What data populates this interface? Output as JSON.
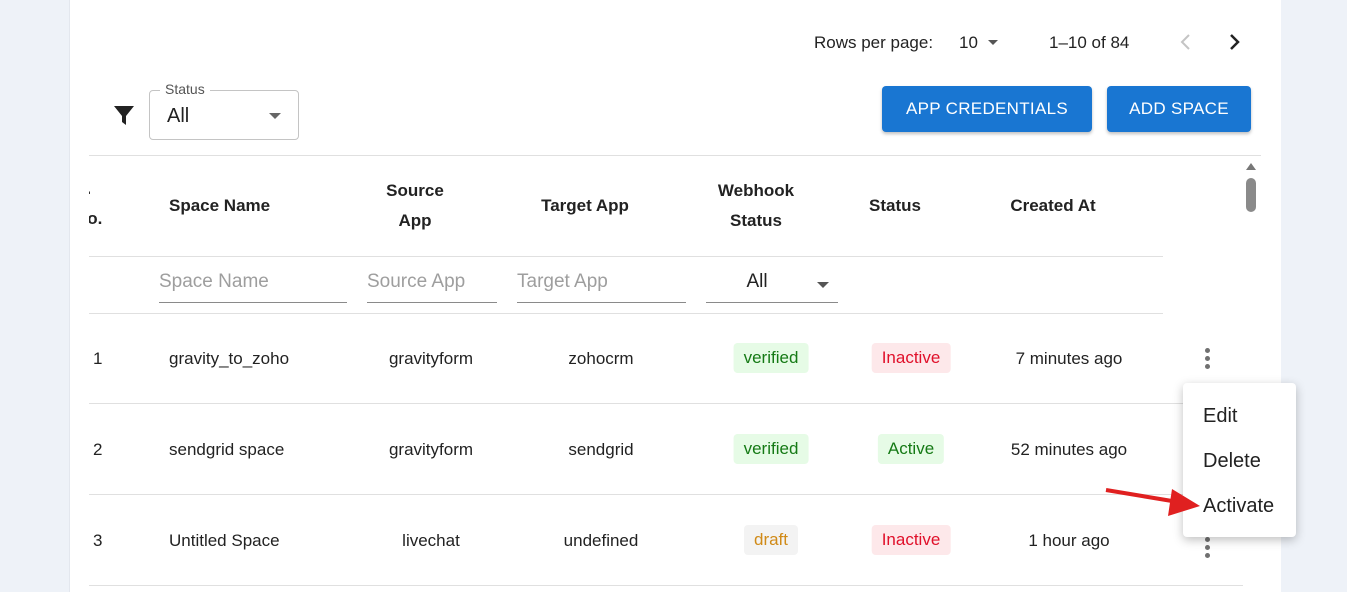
{
  "pagination": {
    "rows_per_page_label": "Rows per page:",
    "rows_per_page": "10",
    "range": "1–10 of 84"
  },
  "filter": {
    "status_label": "Status",
    "status_value": "All"
  },
  "buttons": {
    "app_credentials": "APP CREDENTIALS",
    "add_space": "ADD SPACE"
  },
  "table": {
    "headers": {
      "sno_1": "S.",
      "sno_2": "No.",
      "space_name": "Space Name",
      "source_1": "Source",
      "source_2": "App",
      "target": "Target App",
      "webhook_1": "Webhook",
      "webhook_2": "Status",
      "status": "Status",
      "created": "Created At"
    },
    "filters": {
      "space_name": "Space Name",
      "source_app": "Source App",
      "target_app": "Target App",
      "webhook": "All"
    },
    "rows": [
      {
        "sno": "1",
        "name": "gravity_to_zoho",
        "source": "gravityform",
        "target": "zohocrm",
        "webhook": "verified",
        "status": "Inactive",
        "created": "7 minutes ago"
      },
      {
        "sno": "2",
        "name": "sendgrid space",
        "source": "gravityform",
        "target": "sendgrid",
        "webhook": "verified",
        "status": "Active",
        "created": "52 minutes ago"
      },
      {
        "sno": "3",
        "name": "Untitled Space",
        "source": "livechat",
        "target": "undefined",
        "webhook": "draft",
        "status": "Inactive",
        "created": "1 hour ago"
      }
    ]
  },
  "menu": {
    "items": [
      "Edit",
      "Delete",
      "Activate"
    ]
  },
  "colors": {
    "primary": "#1976d2",
    "annotation_arrow": "#e02020"
  }
}
